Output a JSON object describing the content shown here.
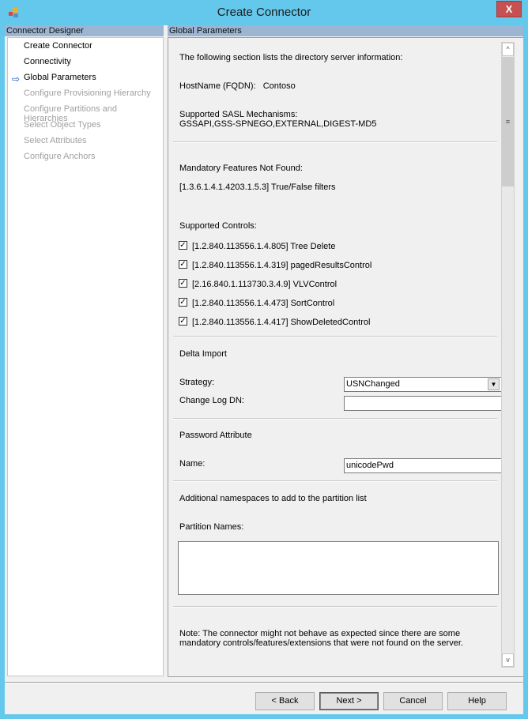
{
  "window": {
    "title": "Create Connector",
    "close_label": "X"
  },
  "left": {
    "header": "Connector Designer",
    "items": [
      {
        "label": "Create Connector",
        "enabled": true
      },
      {
        "label": "Connectivity",
        "enabled": true
      },
      {
        "label": "Global Parameters",
        "enabled": true,
        "current": true
      },
      {
        "label": "Configure Provisioning Hierarchy",
        "enabled": false
      },
      {
        "label": "Configure Partitions and Hierarchies",
        "enabled": false
      },
      {
        "label": "Select Object Types",
        "enabled": false
      },
      {
        "label": "Select Attributes",
        "enabled": false
      },
      {
        "label": "Configure Anchors",
        "enabled": false
      }
    ],
    "current_icon": "right-arrow-icon"
  },
  "main": {
    "header": "Global Parameters",
    "intro": "The following section lists the directory server information:",
    "hostname_label": "HostName (FQDN):",
    "hostname_value": "Contoso",
    "sasl_label": "Supported SASL Mechanisms:",
    "sasl_value": "GSSAPI,GSS-SPNEGO,EXTERNAL,DIGEST-MD5",
    "mandatory_label": "Mandatory Features Not Found:",
    "mandatory_value": "[1.3.6.1.4.1.4203.1.5.3] True/False filters",
    "controls_label": "Supported Controls:",
    "controls": [
      {
        "label": "[1.2.840.113556.1.4.805] Tree Delete",
        "checked": true
      },
      {
        "label": "[1.2.840.113556.1.4.319] pagedResultsControl",
        "checked": true
      },
      {
        "label": "[2.16.840.1.113730.3.4.9] VLVControl",
        "checked": true
      },
      {
        "label": "[1.2.840.113556.1.4.473] SortControl",
        "checked": true
      },
      {
        "label": "[1.2.840.113556.1.4.417] ShowDeletedControl",
        "checked": true
      }
    ],
    "delta_title": "Delta Import",
    "strategy_label": "Strategy:",
    "strategy_value": "USNChanged",
    "changelog_label": "Change Log DN:",
    "changelog_value": "",
    "password_title": "Password Attribute",
    "name_label": "Name:",
    "name_value": "unicodePwd",
    "namespaces_title": "Additional namespaces to add to the partition list",
    "partition_label": "Partition Names:",
    "partition_value": "",
    "note": "Note: The connector might not behave as expected since there are some mandatory controls/features/extensions that were not found on the server."
  },
  "buttons": {
    "back": "< Back",
    "next": "Next >",
    "cancel": "Cancel",
    "help": "Help"
  }
}
